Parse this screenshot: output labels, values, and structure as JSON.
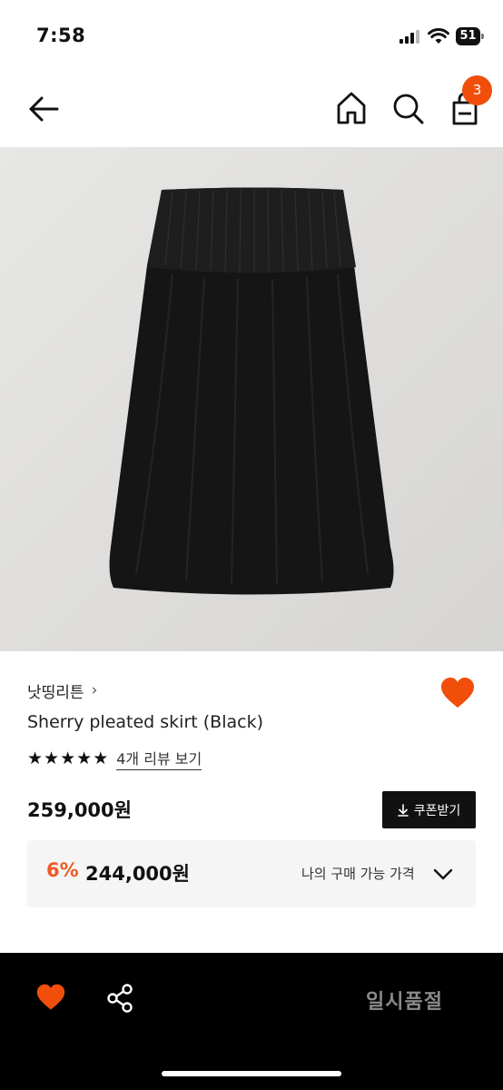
{
  "status_bar": {
    "time": "7:58",
    "battery": "51"
  },
  "header": {
    "cart_count": "3"
  },
  "product": {
    "brand": "낫띵리튼",
    "brand_chevron": "›",
    "name": "Sherry pleated skirt (Black)",
    "rating_stars": 5,
    "review_link": "4개 리뷰 보기",
    "price": "259,000원",
    "coupon_label": "쿠폰받기",
    "discount_rate": "6%",
    "member_price": "244,000원",
    "member_price_label": "나의 구매 가능 가격"
  },
  "bottom_bar": {
    "status_label": "일시품절"
  },
  "colors": {
    "accent": "#f04e0a",
    "discount": "#ee5a24",
    "bottom_bar_bg": "#000000",
    "soldout_text": "#8a8a8a"
  },
  "icons": [
    "back-arrow-icon",
    "home-icon",
    "search-icon",
    "shopping-bag-icon",
    "heart-icon",
    "star-icon",
    "download-icon",
    "chevron-down-icon",
    "share-icon"
  ]
}
